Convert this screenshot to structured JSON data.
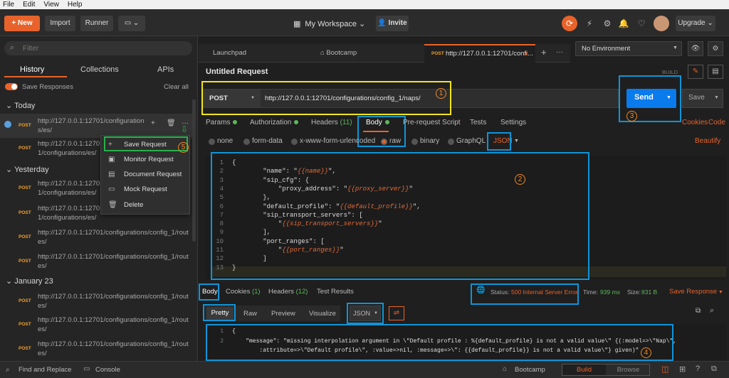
{
  "menubar": [
    "File",
    "Edit",
    "View",
    "Help"
  ],
  "header": {
    "new_label": "New",
    "import_label": "Import",
    "runner_label": "Runner",
    "workspace_label": "My Workspace",
    "invite_label": "Invite",
    "upgrade_label": "Upgrade"
  },
  "sidebar": {
    "filter_placeholder": "Filter",
    "tabs": [
      "History",
      "Collections",
      "APIs"
    ],
    "save_responses_label": "Save Responses",
    "clear_all_label": "Clear all",
    "groups": [
      {
        "title": "Today",
        "requests": [
          {
            "method": "POST",
            "url": "http://127.0.0.1:12701/configurations/es/"
          },
          {
            "method": "POST",
            "url": "http://127.0.0.1:12701/configurations/es/"
          }
        ]
      },
      {
        "title": "Yesterday",
        "requests": [
          {
            "method": "POST",
            "url": "http://127.0.0.1:12701/configurations/es/"
          },
          {
            "method": "POST",
            "url": "http://127.0.0.1:12701/configurations/es/"
          },
          {
            "method": "POST",
            "url": "http://127.0.0.1:12701/configurations/config_1/routes/"
          },
          {
            "method": "POST",
            "url": "http://127.0.0.1:12701/configurations/config_1/routes/"
          }
        ]
      },
      {
        "title": "January 23",
        "requests": [
          {
            "method": "POST",
            "url": "http://127.0.0.1:12701/configurations/config_1/routes/"
          },
          {
            "method": "POST",
            "url": "http://127.0.0.1:12701/configurations/config_1/routes/"
          },
          {
            "method": "POST",
            "url": "http://127.0.0.1:12701/configurations/config_1/routes/"
          }
        ]
      }
    ]
  },
  "context_menu": {
    "items": [
      "Save Request",
      "Monitor Request",
      "Document Request",
      "Mock Request",
      "Delete"
    ]
  },
  "tabs": [
    {
      "label": "Launchpad"
    },
    {
      "label": "Bootcamp"
    },
    {
      "method": "POST",
      "label": "http://127.0.0.1:12701/confi..."
    }
  ],
  "environment": {
    "selected": "No Environment"
  },
  "request": {
    "title": "Untitled Request",
    "build_label": "BUILD",
    "method": "POST",
    "url": "http://127.0.0.1:12701/configurations/config_1/naps/",
    "send_label": "Send",
    "save_label": "Save",
    "subtabs": {
      "params": "Params",
      "authorization": "Authorization",
      "headers": "Headers",
      "headers_count": "(11)",
      "body": "Body",
      "prerequest": "Pre-request Script",
      "tests": "Tests",
      "settings": "Settings",
      "cookies": "Cookies",
      "code": "Code"
    },
    "body_types": [
      "none",
      "form-data",
      "x-www-form-urlencoded",
      "raw",
      "binary",
      "GraphQL"
    ],
    "body_format": "JSON",
    "beautify_label": "Beautify",
    "body_lines": [
      [
        "1",
        [
          [
            "t",
            "{"
          ]
        ]
      ],
      [
        "2",
        [
          [
            "t",
            "        \"name\": \""
          ],
          [
            "v",
            "{{name}}"
          ],
          [
            "t",
            "\","
          ]
        ]
      ],
      [
        "3",
        [
          [
            "t",
            "        \"sip_cfg\": {"
          ]
        ]
      ],
      [
        "4",
        [
          [
            "t",
            "            \"proxy_address\": \""
          ],
          [
            "v",
            "{{proxy_server}}"
          ],
          [
            "t",
            "\""
          ]
        ]
      ],
      [
        "5",
        [
          [
            "t",
            "        },"
          ]
        ]
      ],
      [
        "6",
        [
          [
            "t",
            "        \"default_profile\": \""
          ],
          [
            "v",
            "{{default_profile}}"
          ],
          [
            "t",
            "\","
          ]
        ]
      ],
      [
        "7",
        [
          [
            "t",
            "        \"sip_transport_servers\": ["
          ]
        ]
      ],
      [
        "8",
        [
          [
            "t",
            "            \""
          ],
          [
            "v",
            "{{sip_transport_servers}}"
          ],
          [
            "t",
            "\""
          ]
        ]
      ],
      [
        "9",
        [
          [
            "t",
            "        ],"
          ]
        ]
      ],
      [
        "10",
        [
          [
            "t",
            "        \"port_ranges\": ["
          ]
        ]
      ],
      [
        "11",
        [
          [
            "t",
            "            \""
          ],
          [
            "v",
            "{{port_ranges}}"
          ],
          [
            "t",
            "\""
          ]
        ]
      ],
      [
        "12",
        [
          [
            "t",
            "        ]"
          ]
        ]
      ],
      [
        "13",
        [
          [
            "t",
            "}"
          ]
        ]
      ]
    ]
  },
  "response": {
    "tabs": [
      "Body",
      "Cookies",
      "Headers",
      "Test Results"
    ],
    "cookies_count": "(1)",
    "headers_count": "(12)",
    "status_label": "Status:",
    "status_value": "500 Internal Server Error",
    "time_label": "Time:",
    "time_value": "939 ms",
    "size_label": "Size:",
    "size_value": "831 B",
    "save_response_label": "Save Response",
    "views": [
      "Pretty",
      "Raw",
      "Preview",
      "Visualize"
    ],
    "format": "JSON",
    "lines": [
      [
        "1",
        "{"
      ],
      [
        "2",
        "    \"message\": \"missing interpolation argument in \\\"Default profile : %{default_profile} is not a valid value\\\" {(:model=>\\\"Nap\\\","
      ],
      [
        "",
        "        :attribute=>\\\"Default profile\\\", :value=>nil, :message=>\\\": {{default_profile}} is not a valid value\\\"} given)\""
      ]
    ]
  },
  "annotations": [
    "1",
    "2",
    "3",
    "4",
    "5"
  ],
  "footer": {
    "find_replace": "Find and Replace",
    "console": "Console",
    "bootcamp": "Bootcamp",
    "build": "Build",
    "browse": "Browse"
  },
  "colors": {
    "accent": "#e8632b",
    "send": "#097bed",
    "highlight_blue": "#0f94d8",
    "highlight_yellow": "#f2e51a",
    "highlight_green": "#27b14a",
    "annotation": "#f08a24"
  }
}
